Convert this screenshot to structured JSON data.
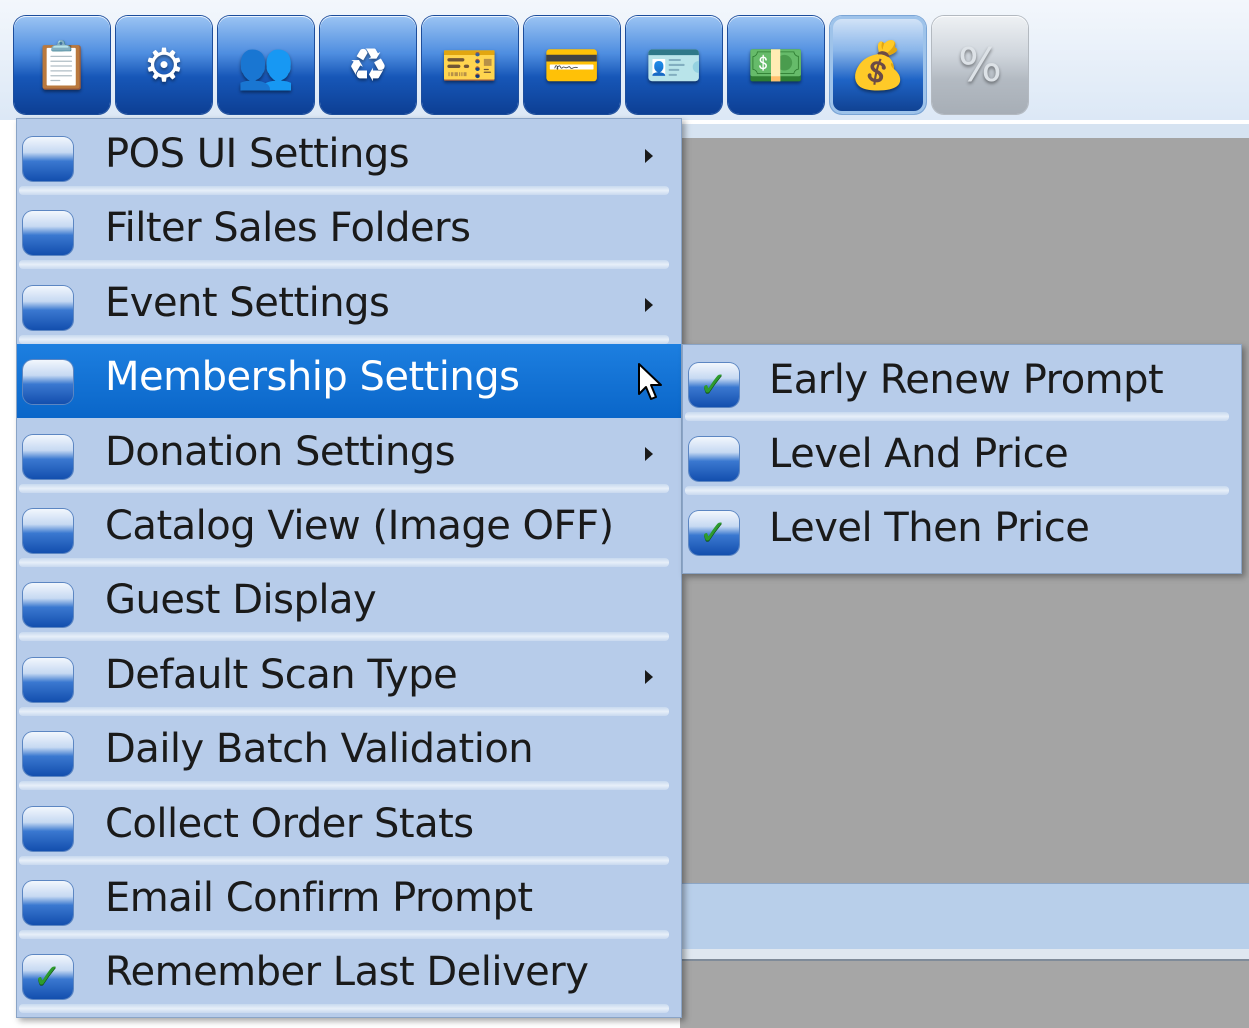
{
  "toolbar": {
    "buttons": [
      {
        "icon": "clipboard-icon",
        "glyph": "📋",
        "active": false,
        "disabled": false
      },
      {
        "icon": "gears-icon",
        "glyph": "⚙",
        "active": false,
        "disabled": false
      },
      {
        "icon": "users-icon",
        "glyph": "👥",
        "active": false,
        "disabled": false
      },
      {
        "icon": "refresh-icon",
        "glyph": "♻",
        "active": false,
        "disabled": false
      },
      {
        "icon": "ticket-icon",
        "glyph": "🎫",
        "active": false,
        "disabled": false
      },
      {
        "icon": "card-icon",
        "glyph": "💳",
        "active": false,
        "disabled": false
      },
      {
        "icon": "id-card-icon",
        "glyph": "🪪",
        "active": false,
        "disabled": false
      },
      {
        "icon": "payment-icon",
        "glyph": "💵",
        "active": false,
        "disabled": false
      },
      {
        "icon": "money-bag-icon",
        "glyph": "💰",
        "active": true,
        "disabled": false
      },
      {
        "icon": "percent-icon",
        "glyph": "%",
        "active": false,
        "disabled": true
      }
    ]
  },
  "main_menu": {
    "items": [
      {
        "label": "POS UI Settings",
        "checked": false,
        "has_submenu": true,
        "highlighted": false
      },
      {
        "label": "Filter Sales Folders",
        "checked": false,
        "has_submenu": false,
        "highlighted": false
      },
      {
        "label": "Event Settings",
        "checked": false,
        "has_submenu": true,
        "highlighted": false
      },
      {
        "label": "Membership Settings",
        "checked": false,
        "has_submenu": true,
        "highlighted": true
      },
      {
        "label": "Donation Settings",
        "checked": false,
        "has_submenu": true,
        "highlighted": false
      },
      {
        "label": "Catalog View (Image OFF)",
        "checked": false,
        "has_submenu": false,
        "highlighted": false
      },
      {
        "label": "Guest Display",
        "checked": false,
        "has_submenu": false,
        "highlighted": false
      },
      {
        "label": "Default Scan Type",
        "checked": false,
        "has_submenu": true,
        "highlighted": false
      },
      {
        "label": "Daily Batch Validation",
        "checked": false,
        "has_submenu": false,
        "highlighted": false
      },
      {
        "label": "Collect Order Stats",
        "checked": false,
        "has_submenu": false,
        "highlighted": false
      },
      {
        "label": "Email Confirm Prompt",
        "checked": false,
        "has_submenu": false,
        "highlighted": false
      },
      {
        "label": "Remember Last Delivery",
        "checked": true,
        "has_submenu": false,
        "highlighted": false
      }
    ]
  },
  "sub_menu": {
    "items": [
      {
        "label": "Early Renew Prompt",
        "checked": true
      },
      {
        "label": "Level And Price",
        "checked": false
      },
      {
        "label": "Level Then Price",
        "checked": true
      }
    ]
  },
  "colors": {
    "menu_background": "#b7ccea",
    "highlight": "#1473d6",
    "content_pane": "#a4a4a4",
    "check": "#2e9b2e"
  }
}
